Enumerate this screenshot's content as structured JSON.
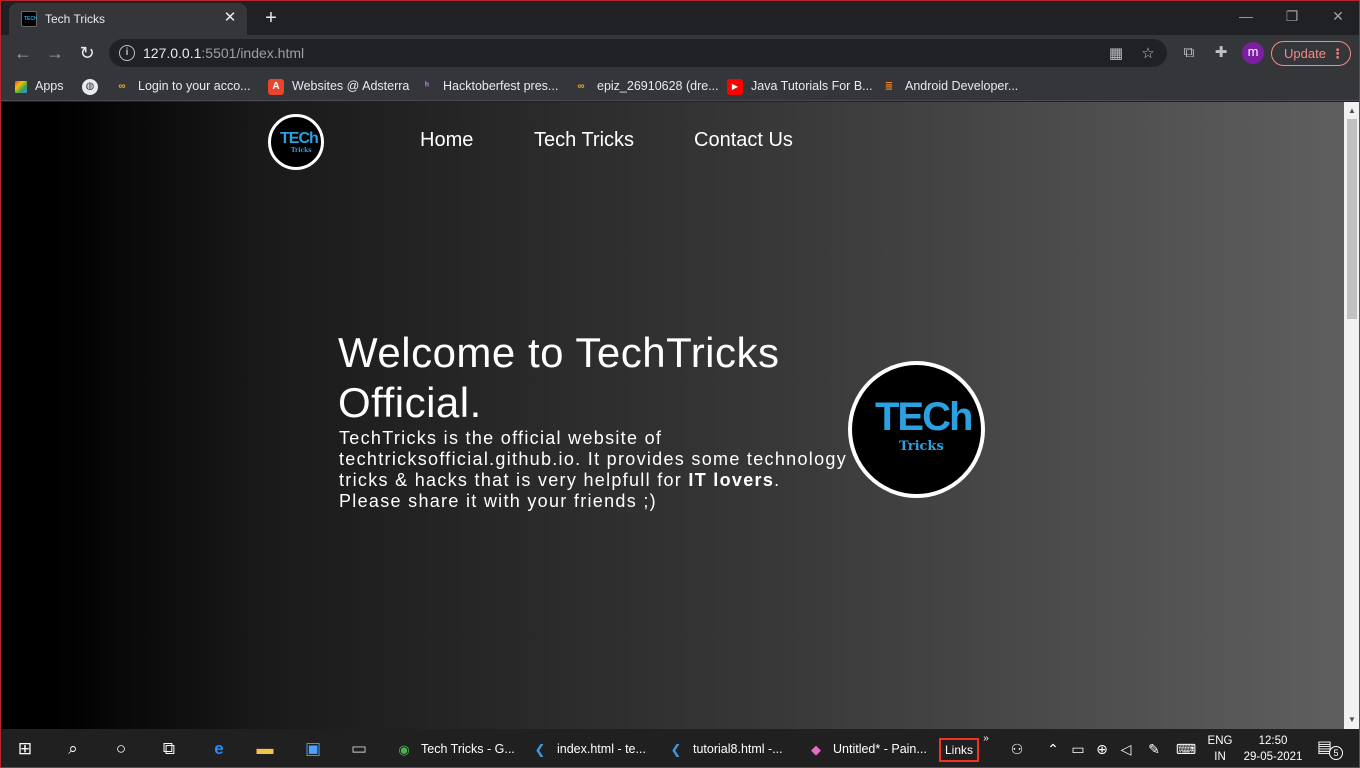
{
  "browser": {
    "tab_title": "Tech Tricks",
    "tab_favicon_text": "TECh",
    "url_host": "127.0.0.1",
    "url_rest": ":5501/index.html",
    "profile_initial": "m",
    "update_label": "Update"
  },
  "bookmarks": [
    {
      "label": "Apps",
      "icon": "apps-grid-icon"
    },
    {
      "label": "",
      "icon": "globe-icon"
    },
    {
      "label": "Login to your acco...",
      "icon": "infinity-icon"
    },
    {
      "label": "Websites @ Adsterra",
      "icon": "adsterra-icon"
    },
    {
      "label": "Hacktoberfest pres...",
      "icon": "hacktoberfest-icon"
    },
    {
      "label": "epiz_26910628 (dre...",
      "icon": "infinity-icon"
    },
    {
      "label": "Java Tutorials For B...",
      "icon": "youtube-icon"
    },
    {
      "label": "Android Developer...",
      "icon": "stackoverflow-icon"
    }
  ],
  "page": {
    "logo_text_main": "TECh",
    "logo_text_sub": "Tricks",
    "nav": [
      "Home",
      "Tech Tricks",
      "Contact Us"
    ],
    "hero_title": "Welcome to TechTricks Official.",
    "hero_text_before": "TechTricks is the official website of techtricksofficial.github.io. It provides some technology tricks & hacks that is very helpfull for ",
    "hero_text_bold": "IT lovers",
    "hero_text_after": ". Please share it with your friends ;)"
  },
  "taskbar": {
    "apps": [
      {
        "label": "Tech Tricks - G...",
        "icon": "chrome-icon"
      },
      {
        "label": "index.html - te...",
        "icon": "vscode-icon"
      },
      {
        "label": "tutorial8.html -...",
        "icon": "vscode-icon"
      },
      {
        "label": "Untitled* - Pain...",
        "icon": "paint3d-icon"
      }
    ],
    "links_label": "Links",
    "lang_line1": "ENG",
    "lang_line2": "IN",
    "time": "12:50",
    "date": "29-05-2021",
    "notification_count": "5"
  },
  "colors": {
    "accent_logo": "#2aa1e0",
    "update_pill": "#f28b82",
    "page_gradient_start": "#000000",
    "page_gradient_end": "#5f5f5f"
  }
}
